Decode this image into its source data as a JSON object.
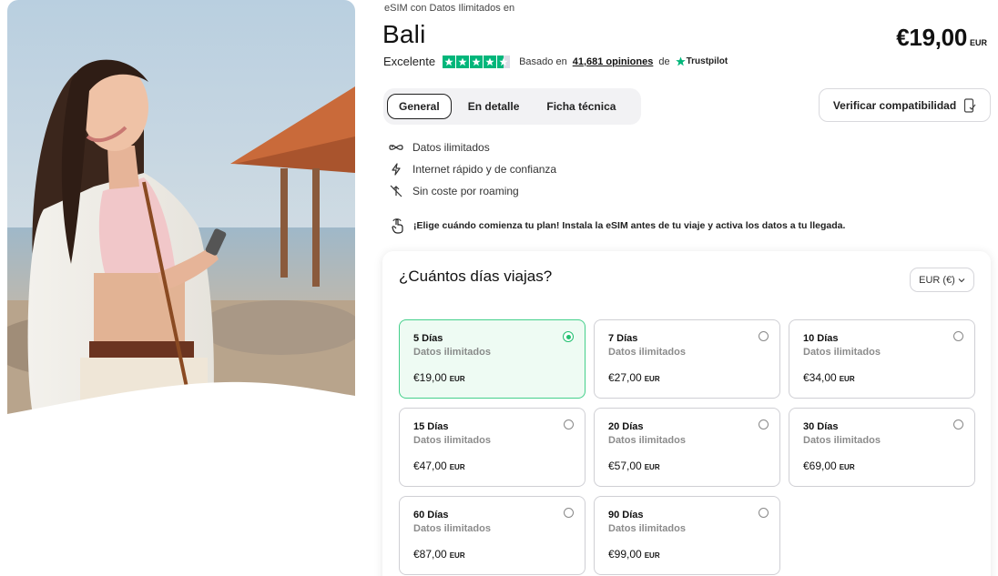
{
  "product": {
    "kicker": "eSIM con Datos Ilimitados en",
    "title": "Bali",
    "price": "€19,00",
    "currency": "EUR"
  },
  "rating": {
    "label": "Excelente",
    "stars": 4.5,
    "based_on": "Basado en",
    "reviews": "41,681 opiniones",
    "de": "de",
    "provider": "Trustpilot"
  },
  "tabs": [
    {
      "label": "General",
      "active": true
    },
    {
      "label": "En detalle",
      "active": false
    },
    {
      "label": "Ficha técnica",
      "active": false
    }
  ],
  "verify_button": {
    "label": "Verificar compatibilidad",
    "icon": "phone-check-icon"
  },
  "features": [
    {
      "icon": "infinity-icon",
      "label": "Datos ilimitados"
    },
    {
      "icon": "lightning-icon",
      "label": "Internet rápido y de confianza"
    },
    {
      "icon": "no-roaming-icon",
      "label": "Sin coste por roaming"
    }
  ],
  "note": {
    "icon": "tap-hand-icon",
    "text": "¡Elige cuándo comienza tu plan! Instala la eSIM antes de tu viaje y activa los datos a tu llegada."
  },
  "plans": {
    "title": "¿Cuántos días viajas?",
    "currency_select": "EUR (€)",
    "options": [
      {
        "days": "5 Días",
        "data": "Datos ilimitados",
        "price": "€19,00",
        "currency": "EUR",
        "selected": true
      },
      {
        "days": "7 Días",
        "data": "Datos ilimitados",
        "price": "€27,00",
        "currency": "EUR",
        "selected": false
      },
      {
        "days": "10 Días",
        "data": "Datos ilimitados",
        "price": "€34,00",
        "currency": "EUR",
        "selected": false
      },
      {
        "days": "15 Días",
        "data": "Datos ilimitados",
        "price": "€47,00",
        "currency": "EUR",
        "selected": false
      },
      {
        "days": "20 Días",
        "data": "Datos ilimitados",
        "price": "€57,00",
        "currency": "EUR",
        "selected": false
      },
      {
        "days": "30 Días",
        "data": "Datos ilimitados",
        "price": "€69,00",
        "currency": "EUR",
        "selected": false
      },
      {
        "days": "60 Días",
        "data": "Datos ilimitados",
        "price": "€87,00",
        "currency": "EUR",
        "selected": false
      },
      {
        "days": "90 Días",
        "data": "Datos ilimitados",
        "price": "€99,00",
        "currency": "EUR",
        "selected": false
      }
    ]
  },
  "colors": {
    "accent_green": "#22c070",
    "selected_bg": "#eefbf3",
    "trustpilot": "#00b67a"
  }
}
